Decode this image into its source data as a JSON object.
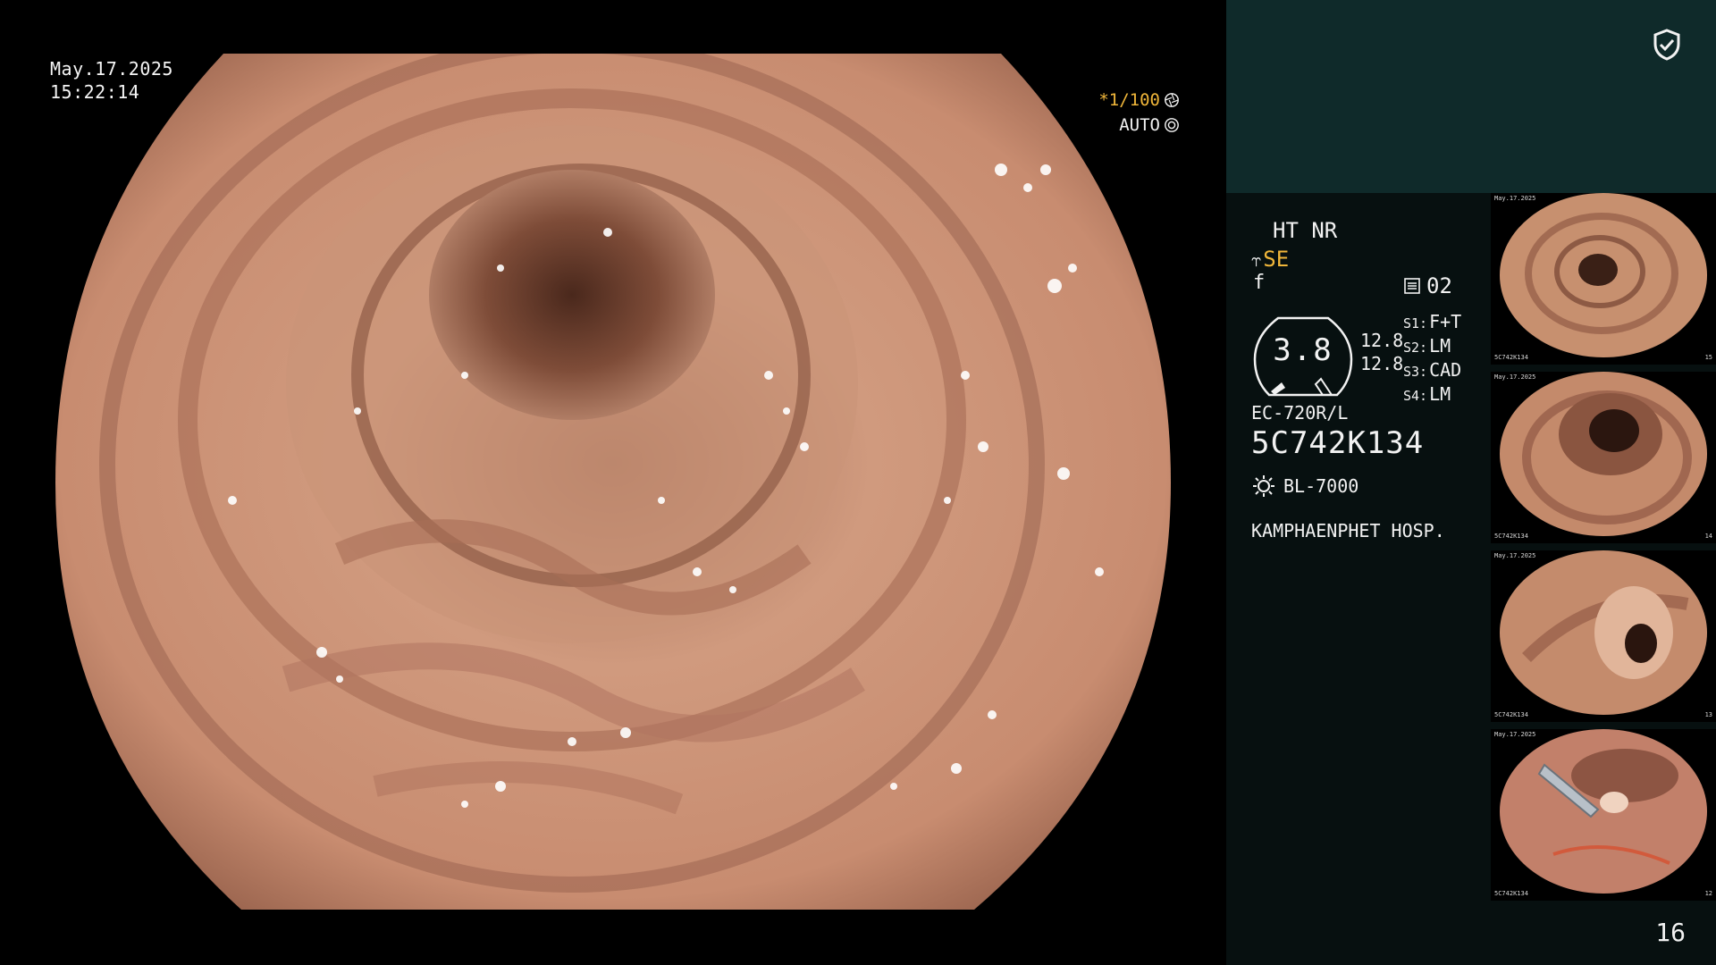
{
  "overlay": {
    "date": "May.17.2025",
    "time": "15:22:14",
    "shutter": "*1/100",
    "iris": "AUTO"
  },
  "panel": {
    "mode_top": "HT NR",
    "mode_se": "SE",
    "mode_f": "f",
    "mode_num": "02",
    "gauge_value": "3.8",
    "gauge_num_1": "12.8",
    "gauge_num_2": "12.8",
    "s_settings": [
      {
        "key": "S1:",
        "val": "F+T"
      },
      {
        "key": "S2:",
        "val": "LM"
      },
      {
        "key": "S3:",
        "val": "CAD"
      },
      {
        "key": "S4:",
        "val": "LM"
      }
    ],
    "scope_model": "EC-720R/L",
    "scope_serial": "5C742K134",
    "light_source": "BL-7000",
    "hospital": "KAMPHAENPHET HOSP.",
    "image_count": "16"
  },
  "thumbnails": [
    {
      "date": "May.17.2025",
      "serial": "5C742K134",
      "num": "15"
    },
    {
      "date": "May.17.2025",
      "serial": "5C742K134",
      "num": "14"
    },
    {
      "date": "May.17.2025",
      "serial": "5C742K134",
      "num": "13"
    },
    {
      "date": "May.17.2025",
      "serial": "5C742K134",
      "num": "12"
    }
  ],
  "colors": {
    "accent": "#f0b63a",
    "panel_bg": "#071010",
    "panel_header": "#0f2a2a",
    "mucosa": "#c98a6e"
  },
  "icons": {
    "shield": "shield-check-icon",
    "light": "sun-icon",
    "shutter": "aperture-icon"
  }
}
